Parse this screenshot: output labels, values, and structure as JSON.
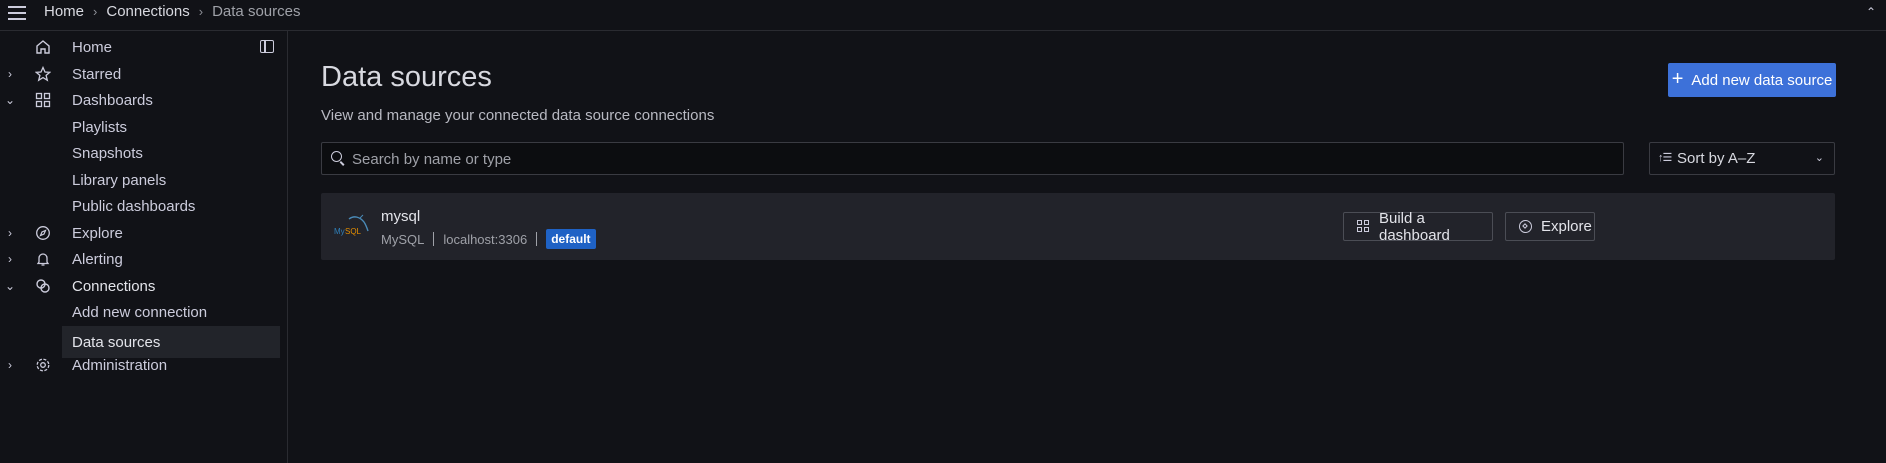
{
  "breadcrumb": {
    "home": "Home",
    "connections": "Connections",
    "current": "Data sources"
  },
  "sidebar": {
    "items": [
      {
        "label": "Home",
        "icon": "home-icon"
      },
      {
        "label": "Starred",
        "icon": "star-icon"
      },
      {
        "label": "Dashboards",
        "icon": "dashboards-grid-icon"
      },
      {
        "label": "Playlists"
      },
      {
        "label": "Snapshots"
      },
      {
        "label": "Library panels"
      },
      {
        "label": "Public dashboards"
      },
      {
        "label": "Explore",
        "icon": "compass-icon"
      },
      {
        "label": "Alerting",
        "icon": "bell-icon"
      },
      {
        "label": "Connections",
        "icon": "connections-icon"
      },
      {
        "label": "Add new connection"
      },
      {
        "label": "Data sources"
      },
      {
        "label": "Administration",
        "icon": "gear-icon"
      }
    ]
  },
  "main": {
    "title": "Data sources",
    "subtitle": "View and manage your connected data source connections",
    "add_button": "Add new data source",
    "search_placeholder": "Search by name or type",
    "sort_label": "Sort by A–Z"
  },
  "datasources": [
    {
      "name": "mysql",
      "type": "MySQL",
      "url": "localhost:3306",
      "badge": "default",
      "build_label": "Build a dashboard",
      "explore_label": "Explore"
    }
  ],
  "colors": {
    "accent": "#3d71d9",
    "active_bar": "#f55f3e",
    "badge": "#1f62c5",
    "background": "#111217"
  }
}
